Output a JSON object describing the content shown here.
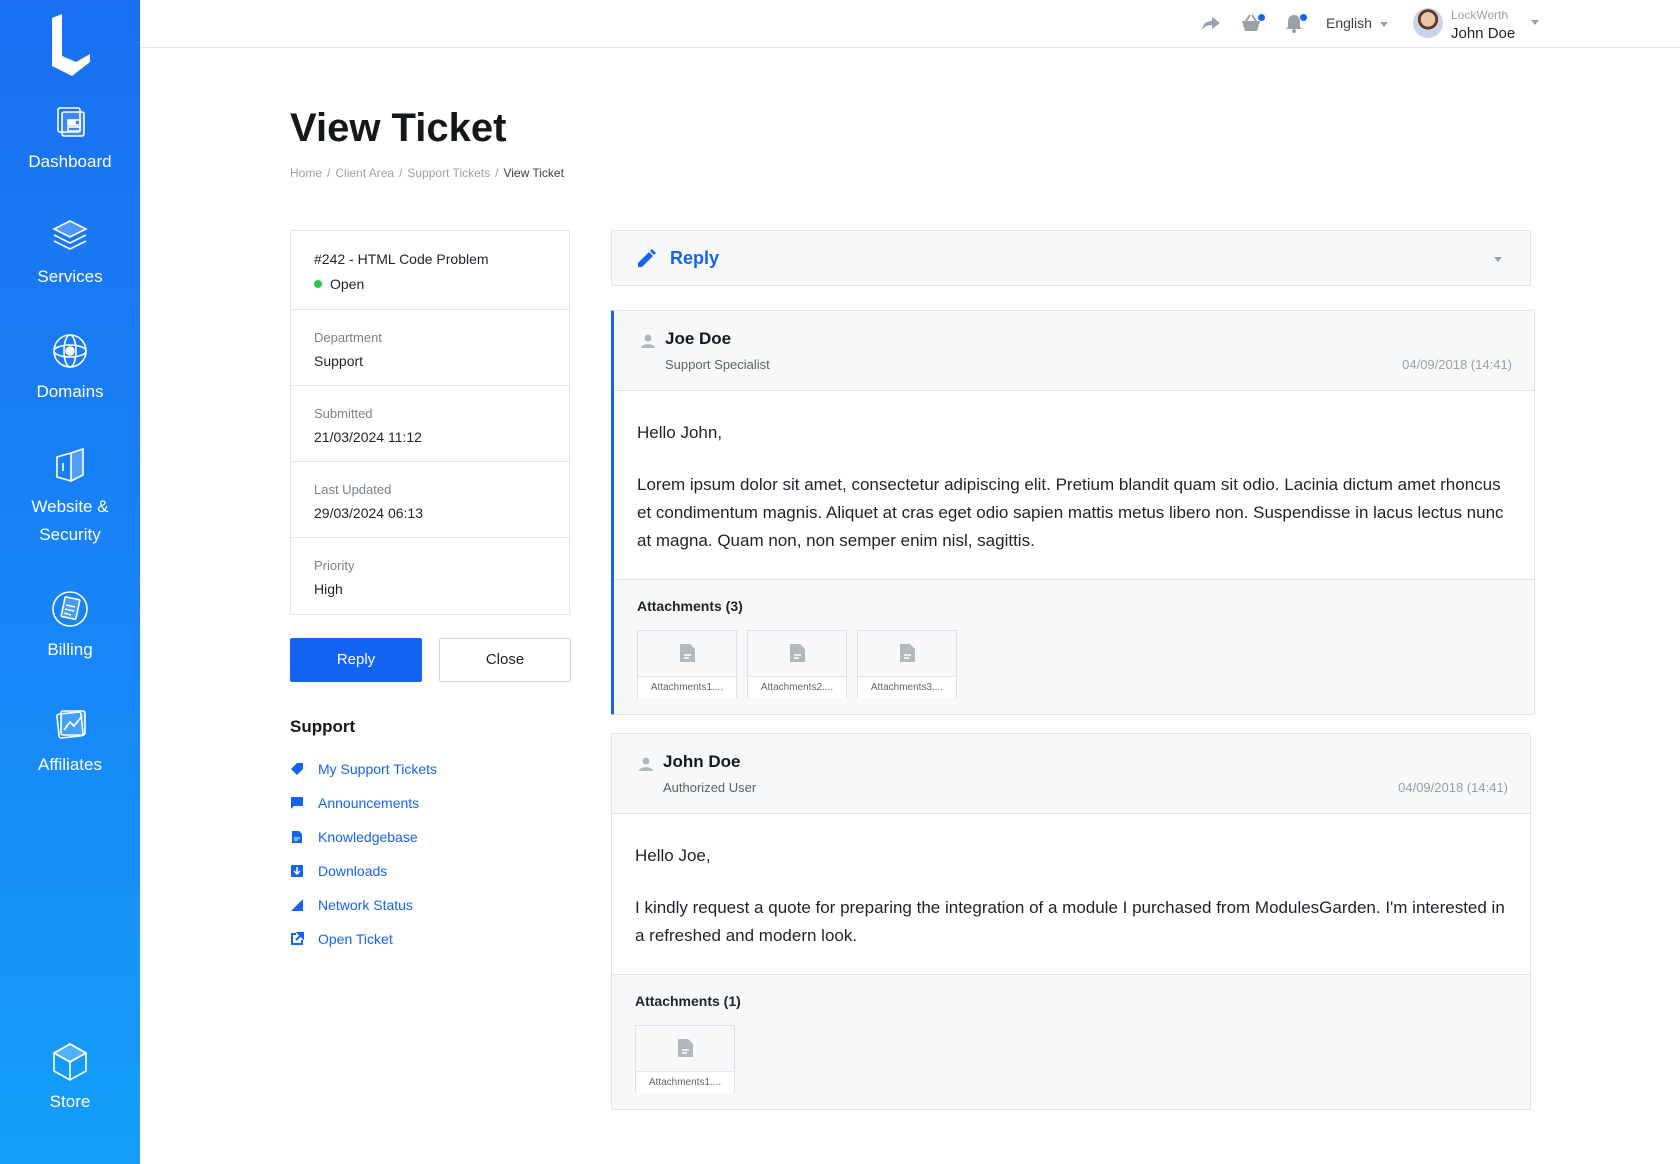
{
  "sidebar": {
    "items": [
      {
        "label": "Dashboard",
        "icon": "dashboard-icon"
      },
      {
        "label": "Services",
        "icon": "services-icon"
      },
      {
        "label": "Domains",
        "icon": "domains-icon"
      },
      {
        "label": "Website &",
        "label2": "Security",
        "icon": "website-security-icon"
      },
      {
        "label": "Billing",
        "icon": "billing-icon"
      },
      {
        "label": "Affiliates",
        "icon": "affiliates-icon"
      }
    ],
    "store": {
      "label": "Store",
      "icon": "store-icon"
    }
  },
  "topbar": {
    "language": "English",
    "user_company": "LockWorth",
    "user_name": "John Doe",
    "accent": "#1563f3"
  },
  "page": {
    "title": "View Ticket",
    "breadcrumb": [
      "Home",
      "Client Area",
      "Support Tickets",
      "View Ticket"
    ]
  },
  "ticket": {
    "title": "#242 - HTML Code Problem",
    "status": "Open",
    "status_color": "#27c94d",
    "fields": [
      {
        "key": "Department",
        "value": "Support"
      },
      {
        "key": "Submitted",
        "value": "21/03/2024 11:12"
      },
      {
        "key": "Last Updated",
        "value": "29/03/2024 06:13"
      },
      {
        "key": "Priority",
        "value": "High"
      }
    ],
    "reply_button": "Reply",
    "close_button": "Close"
  },
  "support": {
    "title": "Support",
    "links": [
      {
        "label": "My Support Tickets",
        "icon": "tag-icon"
      },
      {
        "label": "Announcements",
        "icon": "flag-icon"
      },
      {
        "label": "Knowledgebase",
        "icon": "document-icon"
      },
      {
        "label": "Downloads",
        "icon": "download-icon"
      },
      {
        "label": "Network Status",
        "icon": "signal-icon"
      },
      {
        "label": "Open Ticket",
        "icon": "external-link-icon"
      }
    ]
  },
  "reply_panel": {
    "label": "Reply"
  },
  "messages": [
    {
      "name": "Joe Doe",
      "role": "Support Specialist",
      "date": "04/09/2018 (14:41)",
      "greeting": "Hello John,",
      "body": "Lorem ipsum dolor sit amet, consectetur adipiscing elit. Pretium blandit quam sit odio. Lacinia dictum amet rhoncus et condimentum magnis. Aliquet at cras eget odio sapien mattis metus libero non. Suspendisse in lacus lectus nunc at magna. Quam non, non semper enim nisl, sagittis.",
      "attachments_title": "Attachments (3)",
      "attachments": [
        "Attachments1....",
        "Attachments2....",
        "Attachments3...."
      ]
    },
    {
      "name": "John Doe",
      "role": "Authorized User",
      "date": "04/09/2018 (14:41)",
      "greeting": "Hello Joe,",
      "body": "I kindly request a quote for preparing the integration of a module I purchased from ModulesGarden. I'm interested in a refreshed and modern look.",
      "attachments_title": "Attachments (1)",
      "attachments": [
        "Attachments1...."
      ]
    }
  ]
}
